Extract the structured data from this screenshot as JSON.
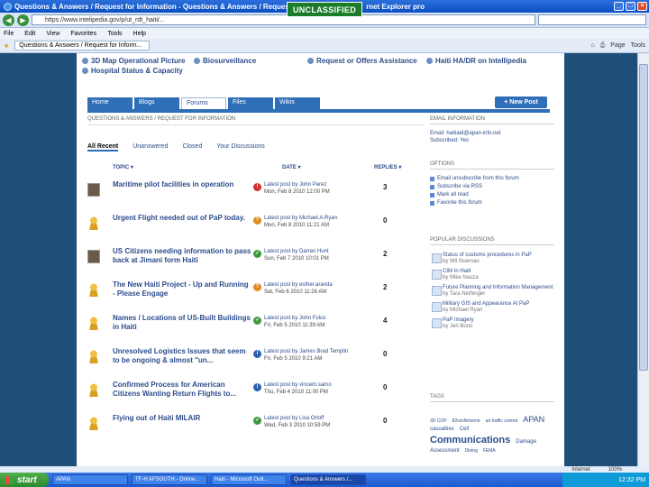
{
  "browser": {
    "title": "Questions & Answers / Request for Information - Questions & Answers / Request for Info",
    "title_tail": "rnet Explorer pro",
    "classification": "UNCLASSIFIED",
    "address": "https://www.intelipedia.gov/p/ut_rdt_haiti/...",
    "search_placeholder": "",
    "menu": [
      "File",
      "Edit",
      "View",
      "Favorites",
      "Tools",
      "Help"
    ],
    "fav_tab": "Questions & Answers / Request for Inform...",
    "tools": [
      "Page",
      "Tools"
    ]
  },
  "toplinks": [
    "3D Map Operational Picture",
    "Biosurveillance",
    "Request or Offers Assistance",
    "Haiti HA/DR on Intellipedia",
    "Hospital Status & Capacity"
  ],
  "tabs": [
    "Home",
    "Blogs",
    "Forums",
    "Files",
    "Wikis"
  ],
  "active_tab": "Forums",
  "new_post": "New Post",
  "qa_header": "Questions & Answers / Request for Information",
  "subtabs": [
    "All Recent",
    "Unanswered",
    "Closed",
    "Your Discussions"
  ],
  "columns": {
    "topic": "TOPIC",
    "date": "DATE",
    "replies": "REPLIES"
  },
  "rows": [
    {
      "topic": "Maritime pilot facilities in operation",
      "latest": "Latest post by John Perez",
      "date": "Mon, Feb 8 2010 12:00 PM",
      "replies": "3",
      "status": "red",
      "avatar": "photo"
    },
    {
      "topic": "Urgent Flight needed out of PaP today.",
      "latest": "Latest post by Michael.A.Ryan",
      "date": "Mon, Feb 8 2010 11:21 AM",
      "replies": "0",
      "status": "orange",
      "avatar": "person"
    },
    {
      "topic": "US Citizens needing information to pass back at Jimani form Haiti",
      "latest": "Latest post by Darren Hunt",
      "date": "Sun, Feb 7 2010 10:01 PM",
      "replies": "2",
      "status": "green",
      "avatar": "photo"
    },
    {
      "topic": "The New Haiti Project - Up and Running - Please Engage",
      "latest": "Latest post by esther.aranda",
      "date": "Sat, Feb 6 2010 11:26 AM",
      "replies": "2",
      "status": "orange",
      "avatar": "person"
    },
    {
      "topic": "Names / Locations of US-Built Buildings in Haiti",
      "latest": "Latest post by John Fulco",
      "date": "Fri, Feb 5 2010 11:39 AM",
      "replies": "4",
      "status": "green",
      "avatar": "person"
    },
    {
      "topic": "Unresolved Logistics Issues that seem to be ongoing & almost \"un...",
      "latest": "Latest post by James Brad Templin",
      "date": "Fri, Feb 5 2010 9:21 AM",
      "replies": "0",
      "status": "blue",
      "avatar": "person"
    },
    {
      "topic": "Confirmed Process for American Citizens Wanting Return Flights to...",
      "latest": "Latest post by vincent.sarno",
      "date": "Thu, Feb 4 2010 11:00 PM",
      "replies": "0",
      "status": "blue",
      "avatar": "person"
    },
    {
      "topic": "Flying out of Haiti MILAIR",
      "latest": "Latest post by Lisa Orloff",
      "date": "Wed, Feb 3 2010 10:59 PM",
      "replies": "0",
      "status": "green",
      "avatar": "person"
    }
  ],
  "sidebar": {
    "email_header": "EMAIL INFORMATION",
    "email_line": "Email: haitiaid@apan-info.net",
    "subscribed": "Subscribed: Yes",
    "options_header": "OPTIONS",
    "options": [
      "Email unsubscribe from this forum",
      "Subscribe via RSS",
      "Mark all read",
      "Favorite this forum"
    ],
    "hot_header": "POPULAR DISCUSSIONS",
    "hot": [
      {
        "title": "Status of customs procedures in PaP",
        "by": "by Wil Nueman"
      },
      {
        "title": "CIM In Haiti",
        "by": "by Mike Nauza"
      },
      {
        "title": "Future Planning and Information Management",
        "by": "by Tara Nethinger"
      },
      {
        "title": "Military GIS and Appearance At PaP",
        "by": "by Michael Ryan"
      },
      {
        "title": "PaP Imagery",
        "by": "by Jeri Bono"
      }
    ],
    "tags_header": "TAGS",
    "tags_small": [
      "3D COP",
      "82nd Airborne",
      "air traffic control"
    ],
    "tags_mid": [
      "APAN",
      "casualties",
      "Cell"
    ],
    "tags_big": "Communications",
    "tags_tail": [
      "Damage",
      "Assessment",
      "Dining",
      "FEMA"
    ]
  },
  "status": {
    "zone": "Internet",
    "zoom": "100%"
  },
  "taskbar": {
    "start": "start",
    "tasks": [
      "APAN",
      "TF-H AFSOUTH - Online...",
      "Haiti - Microsoft Outl...",
      "Questions & Answers /..."
    ],
    "clock": "12:32 PM"
  }
}
